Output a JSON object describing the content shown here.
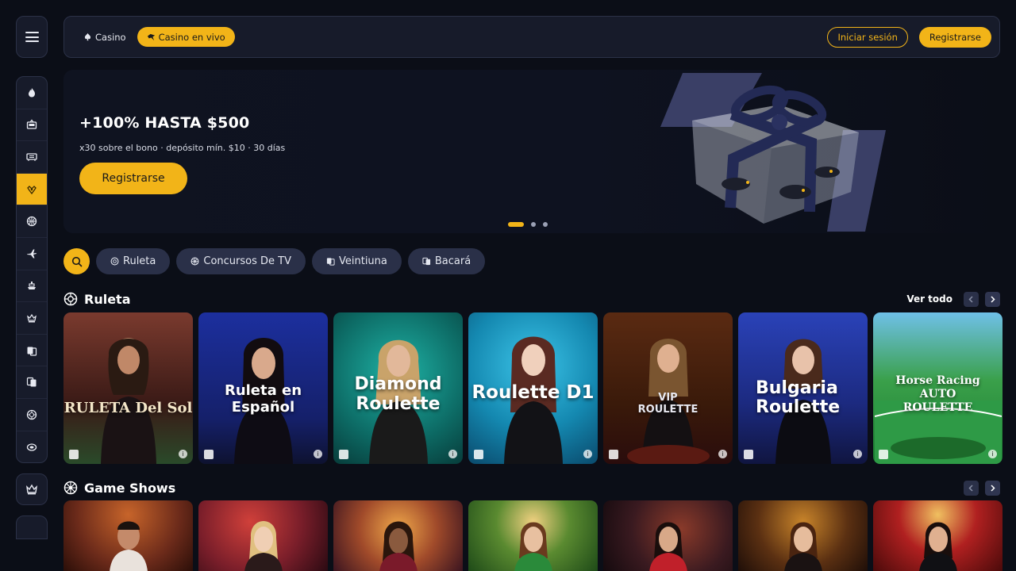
{
  "topnav": {
    "tabs": [
      {
        "label": "Casino",
        "icon": "spade-icon",
        "active": false
      },
      {
        "label": "Casino en vivo",
        "icon": "dealer-icon",
        "active": true
      }
    ],
    "login_label": "Iniciar sesión",
    "register_label": "Registrarse"
  },
  "sidebar": {
    "items": [
      {
        "icon": "fire-icon"
      },
      {
        "icon": "slot-machine-icon"
      },
      {
        "icon": "cards-icon"
      },
      {
        "icon": "live-dealer-icon",
        "active": true
      },
      {
        "icon": "basketball-icon"
      },
      {
        "icon": "airplane-icon"
      },
      {
        "icon": "ship-icon"
      },
      {
        "icon": "crown-table-icon"
      },
      {
        "icon": "blackjack-icon"
      },
      {
        "icon": "baccarat-icon"
      },
      {
        "icon": "roulette-icon"
      },
      {
        "icon": "chip-icon"
      }
    ],
    "extra_icon": "crown-icon"
  },
  "banner": {
    "title": "+100% HASTA $500",
    "subtitle": "x30 sobre el bono · depósito mín. $10 · 30 días",
    "cta_label": "Registrarse",
    "slide_count": 3,
    "active_slide": 1
  },
  "filters": {
    "search_icon": "search-icon",
    "chips": [
      {
        "label": "Ruleta",
        "icon": "roulette-icon"
      },
      {
        "label": "Concursos De TV",
        "icon": "wheel-icon"
      },
      {
        "label": "Veintiuna",
        "icon": "blackjack-icon"
      },
      {
        "label": "Bacará",
        "icon": "baccarat-icon"
      }
    ]
  },
  "sections": {
    "ruleta": {
      "title": "Ruleta",
      "see_all": "Ver todo",
      "games": [
        {
          "label": "RULETA Del Sol",
          "bg": "#5a2a25"
        },
        {
          "label": "Ruleta en Español",
          "bg": "#1b2b8a"
        },
        {
          "label": "Diamond Roulette",
          "bg": "#0f7f78"
        },
        {
          "label": "Roulette D1",
          "bg": "#1495b8"
        },
        {
          "label": "VIP ROULETTE",
          "bg": "#4a2512"
        },
        {
          "label": "Bulgaria Roulette",
          "bg": "#243aa0"
        },
        {
          "label": "Horse Racing AUTO ROULETTE",
          "bg": "#1f8a3e"
        }
      ]
    },
    "game_shows": {
      "title": "Game Shows",
      "games": [
        {
          "bg": "#6b2a1a"
        },
        {
          "bg": "#7a1e2a"
        },
        {
          "bg": "#6a1f2a"
        },
        {
          "bg": "#3c6a28"
        },
        {
          "bg": "#3a1a20"
        },
        {
          "bg": "#5b3012"
        },
        {
          "bg": "#9a1a1a"
        }
      ]
    }
  },
  "colors": {
    "accent": "#f2b418",
    "background": "#0b0e17",
    "panel": "#171b2a",
    "chip": "#2a3048"
  }
}
